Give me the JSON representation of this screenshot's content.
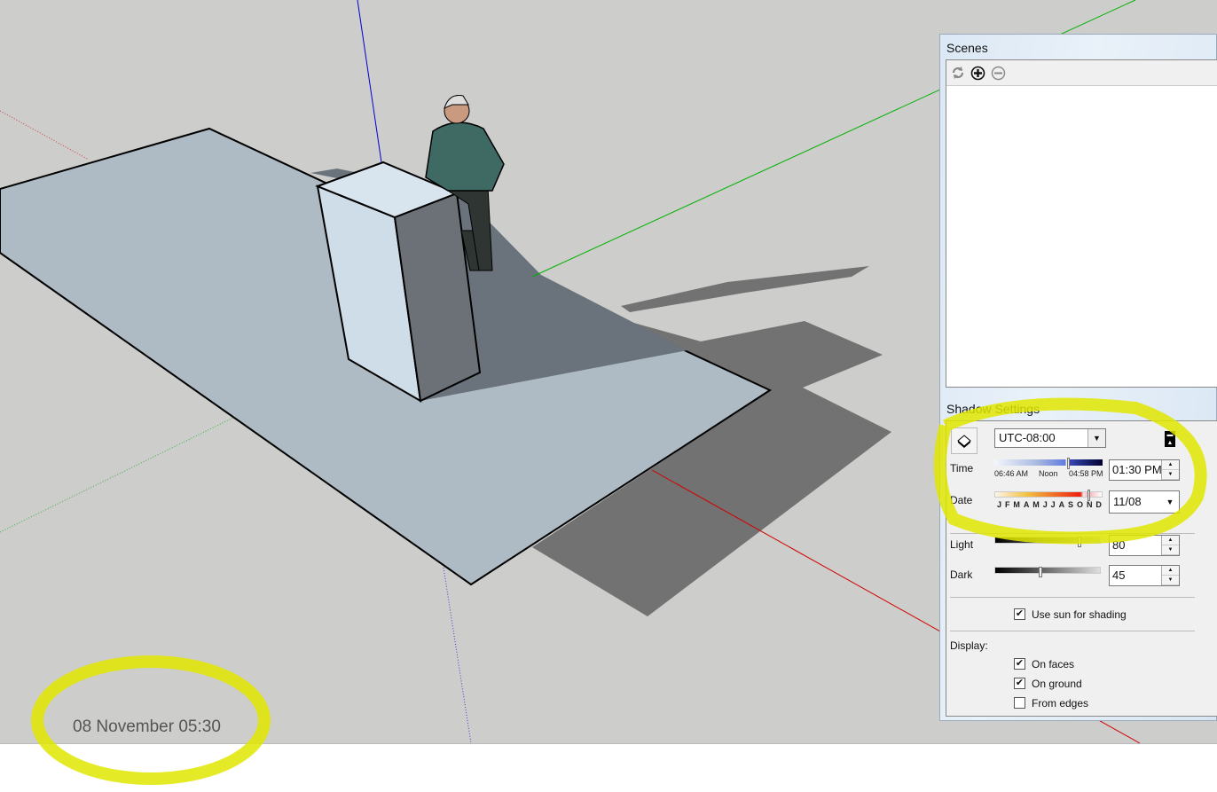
{
  "viewport": {
    "date_time_label": "08 November 05:30",
    "axis_colors": {
      "red": "#d00000",
      "green": "#00b000",
      "blue": "#0000d0"
    },
    "highlight_color": "#e8ee00"
  },
  "scenes": {
    "title": "Scenes",
    "tools": [
      {
        "icon": "refresh-icon"
      },
      {
        "icon": "add-scene-icon"
      },
      {
        "icon": "remove-scene-icon"
      }
    ]
  },
  "shadow_settings": {
    "title": "Shadow Settings",
    "timezone": "UTC-08:00",
    "time": {
      "label": "Time",
      "sunrise": "06:46 AM",
      "noon": "Noon",
      "sunset": "04:58 PM",
      "value": "01:30 PM"
    },
    "date": {
      "label": "Date",
      "months": [
        "J",
        "F",
        "M",
        "A",
        "M",
        "J",
        "J",
        "A",
        "S",
        "O",
        "N",
        "D"
      ],
      "value": "11/08"
    },
    "light": {
      "label": "Light",
      "value": "80"
    },
    "dark": {
      "label": "Dark",
      "value": "45"
    },
    "use_sun": {
      "label": "Use sun for shading",
      "checked": true
    },
    "display": {
      "label": "Display:",
      "on_faces": {
        "label": "On faces",
        "checked": true
      },
      "on_ground": {
        "label": "On ground",
        "checked": true
      },
      "from_edges": {
        "label": "From edges",
        "checked": false
      }
    }
  }
}
